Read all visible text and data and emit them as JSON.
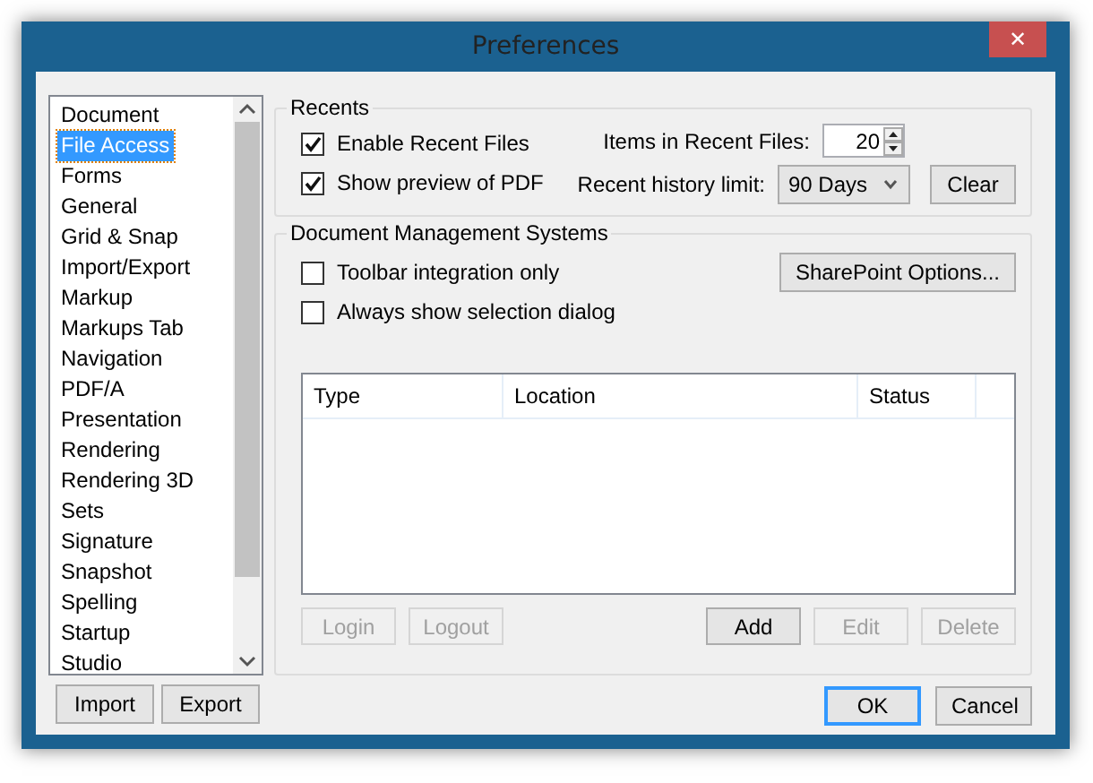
{
  "window": {
    "title": "Preferences",
    "close": "✕"
  },
  "sidebar": {
    "items": [
      {
        "label": "Document",
        "selected": false
      },
      {
        "label": "File Access",
        "selected": true
      },
      {
        "label": "Forms",
        "selected": false
      },
      {
        "label": "General",
        "selected": false
      },
      {
        "label": "Grid & Snap",
        "selected": false
      },
      {
        "label": "Import/Export",
        "selected": false
      },
      {
        "label": "Markup",
        "selected": false
      },
      {
        "label": "Markups Tab",
        "selected": false
      },
      {
        "label": "Navigation",
        "selected": false
      },
      {
        "label": "PDF/A",
        "selected": false
      },
      {
        "label": "Presentation",
        "selected": false
      },
      {
        "label": "Rendering",
        "selected": false
      },
      {
        "label": "Rendering 3D",
        "selected": false
      },
      {
        "label": "Sets",
        "selected": false
      },
      {
        "label": "Signature",
        "selected": false
      },
      {
        "label": "Snapshot",
        "selected": false
      },
      {
        "label": "Spelling",
        "selected": false
      },
      {
        "label": "Startup",
        "selected": false
      },
      {
        "label": "Studio",
        "selected": false
      }
    ],
    "buttons": [
      "Import",
      "Export"
    ]
  },
  "recents": {
    "title": "Recents",
    "checkboxes": [
      {
        "label": "Enable Recent Files",
        "checked": true
      },
      {
        "label": "Show preview of PDF",
        "checked": true
      }
    ],
    "items_label": "Items in Recent Files:",
    "items_value": "20",
    "history_label": "Recent history limit:",
    "history_value": "90 Days",
    "clear": "Clear"
  },
  "dms": {
    "title": "Document Management Systems",
    "checkboxes": [
      {
        "label": "Toolbar integration only",
        "checked": false
      },
      {
        "label": "Always show selection dialog",
        "checked": false
      }
    ],
    "sharepoint": "SharePoint Options...",
    "table": {
      "columns": [
        "Type",
        "Location",
        "Status"
      ]
    },
    "buttons": [
      {
        "label": "Login",
        "disabled": true
      },
      {
        "label": "Logout",
        "disabled": true
      },
      {
        "label": "Add",
        "disabled": false
      },
      {
        "label": "Edit",
        "disabled": true
      },
      {
        "label": "Delete",
        "disabled": true
      }
    ]
  },
  "footer": {
    "buttons": [
      {
        "label": "OK",
        "focused": true
      },
      {
        "label": "Cancel",
        "focused": false
      }
    ]
  }
}
